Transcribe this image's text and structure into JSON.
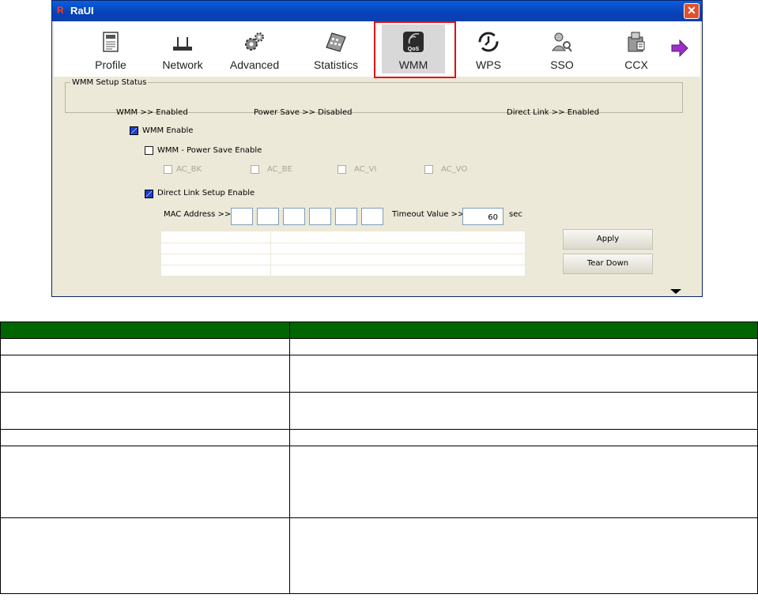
{
  "window": {
    "title": "RaUI",
    "close_glyph": "✕"
  },
  "toolbar": {
    "items": [
      {
        "label": "Profile",
        "icon": "profile-icon"
      },
      {
        "label": "Network",
        "icon": "network-icon"
      },
      {
        "label": "Advanced",
        "icon": "advanced-gears-icon"
      },
      {
        "label": "Statistics",
        "icon": "statistics-icon"
      },
      {
        "label": "WMM",
        "icon": "qos-icon",
        "icon_text": "QoS",
        "active": true
      },
      {
        "label": "WPS",
        "icon": "wps-icon"
      },
      {
        "label": "SSO",
        "icon": "sso-icon"
      },
      {
        "label": "CCX",
        "icon": "ccx-icon"
      }
    ],
    "next_icon": "next-arrow-icon"
  },
  "status": {
    "legend": "WMM Setup Status",
    "wmm": "WMM >> Enabled",
    "power_save": "Power Save >> Disabled",
    "direct_link": "Direct Link >> Enabled"
  },
  "options": {
    "wmm_enable": {
      "label": "WMM Enable",
      "checked": true
    },
    "power_save_enable": {
      "label": "WMM - Power Save Enable",
      "checked": false
    },
    "ac": [
      "AC_BK",
      "AC_BE",
      "AC_VI",
      "AC_VO"
    ],
    "direct_link_enable": {
      "label": "Direct Link Setup Enable",
      "checked": true
    },
    "mac_label": "MAC Address >>",
    "timeout_label": "Timeout Value >>",
    "timeout_value": "60",
    "timeout_unit": "sec"
  },
  "buttons": {
    "apply": "Apply",
    "tear_down": "Tear Down"
  },
  "colors": {
    "highlight": "#e01010",
    "table_header": "#006600",
    "checkbox_checked": "#1a3fd0"
  }
}
